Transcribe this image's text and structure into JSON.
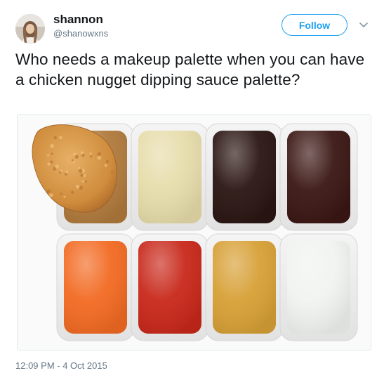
{
  "tweet": {
    "author": {
      "display_name": "shannon",
      "handle": "@shanowxns"
    },
    "follow_label": "Follow",
    "text": "Who needs a makeup palette when you can have a chicken nugget dipping sauce palette?",
    "timestamp": "12:09 PM - 4 Oct 2015",
    "media": {
      "icon": "photo",
      "sauces": [
        {
          "color": "#b07a3c"
        },
        {
          "color": "#e6dcaa"
        },
        {
          "color": "#2a1512"
        },
        {
          "color": "#3a1613"
        },
        {
          "color": "#f26a22"
        },
        {
          "color": "#c8281a"
        },
        {
          "color": "#d7a036"
        },
        {
          "color": "#f1f3f0"
        }
      ],
      "nugget_color": "#d69a4a"
    },
    "colors": {
      "accent": "#1da1f2",
      "text": "#14171a",
      "muted": "#657786"
    }
  }
}
